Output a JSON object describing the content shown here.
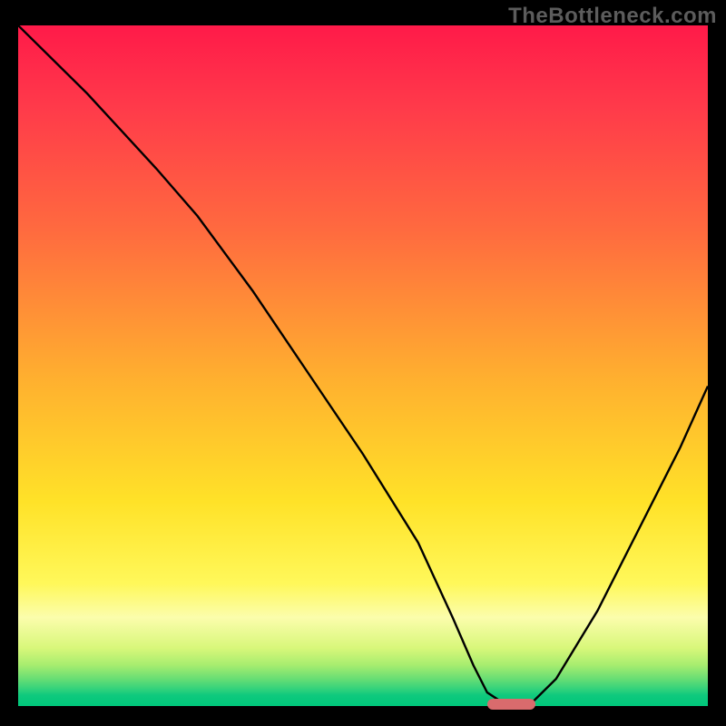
{
  "watermark": "TheBottleneck.com",
  "colors": {
    "frame_bg": "#000000",
    "watermark": "#5c5c5c",
    "curve": "#000000",
    "marker": "#d96b6d",
    "gradient_top": "#ff1a49",
    "gradient_bottom": "#00c77b"
  },
  "chart_data": {
    "type": "line",
    "title": "",
    "xlabel": "",
    "ylabel": "",
    "xlim": [
      0,
      100
    ],
    "ylim": [
      0,
      100
    ],
    "grid": false,
    "legend": false,
    "series": [
      {
        "name": "bottleneck-curve",
        "x": [
          0,
          10,
          20,
          26,
          34,
          42,
          50,
          58,
          63,
          66,
          68,
          71,
          74,
          78,
          84,
          90,
          96,
          100
        ],
        "values": [
          100,
          90,
          79,
          72,
          61,
          49,
          37,
          24,
          13,
          6,
          2,
          0,
          0,
          4,
          14,
          26,
          38,
          47
        ]
      }
    ],
    "annotations": [
      {
        "name": "optimal-marker",
        "x_start": 68,
        "x_end": 75,
        "y": 0
      }
    ]
  }
}
